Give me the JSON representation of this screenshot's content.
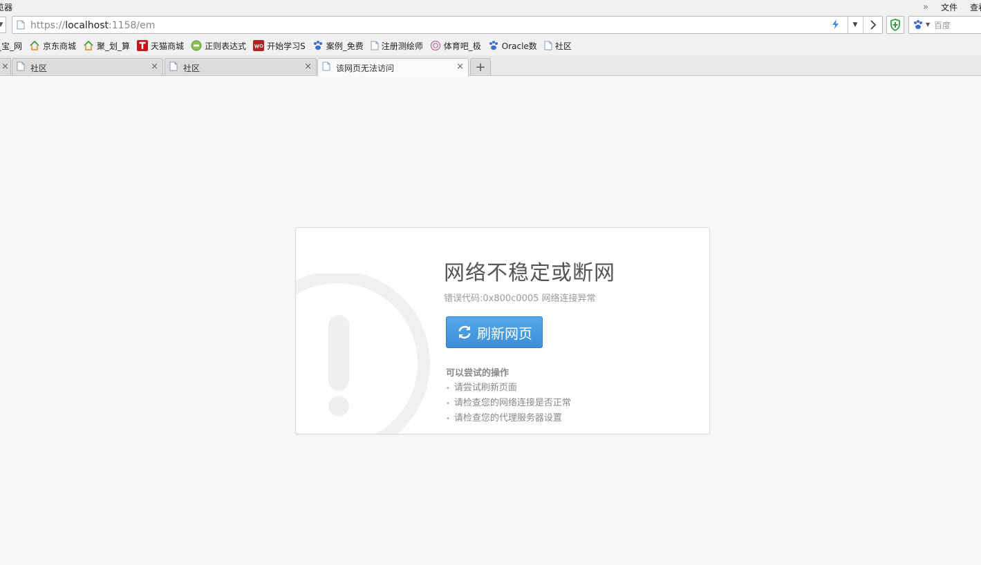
{
  "window": {
    "app_name_partial": "览器",
    "menu": [
      "文件",
      "查看"
    ]
  },
  "address": {
    "url_scheme": "https://",
    "url_host": "localhost",
    "url_rest": ":1158/em",
    "search_placeholder": "百度"
  },
  "bookmarks": [
    {
      "label": "_宝_网",
      "icon": "none"
    },
    {
      "label": "京东商城",
      "icon": "house-2345-icon"
    },
    {
      "label": "聚_划_算",
      "icon": "house-2345-icon"
    },
    {
      "label": "天猫商城",
      "icon": "tmall-icon"
    },
    {
      "label": "正则表达式",
      "icon": "green-circle-icon"
    },
    {
      "label": "开始学习S",
      "icon": "w3c-icon"
    },
    {
      "label": "案例_免费",
      "icon": "paw-icon"
    },
    {
      "label": "注册测绘师",
      "icon": "page-icon"
    },
    {
      "label": "体育吧_极",
      "icon": "swirl-icon"
    },
    {
      "label": "Oracle数",
      "icon": "paw-icon"
    },
    {
      "label": "社区",
      "icon": "page-icon"
    }
  ],
  "tabs": [
    {
      "label": "社区",
      "active": false
    },
    {
      "label": "社区",
      "active": false
    },
    {
      "label": "该网页无法访问",
      "active": true
    }
  ],
  "tab_close_glyph": "×",
  "newtab_glyph": "+",
  "error": {
    "title": "网络不稳定或断网",
    "code_text": "错误代码:0x800c0005 网络连接异常",
    "refresh_label": "刷新网页",
    "suggestions_title": "可以尝试的操作",
    "suggestions": [
      "请尝试刷新页面",
      "请检查您的网络连接是否正常",
      "请检查您的代理服务器设置"
    ]
  },
  "colors": {
    "button_blue": "#3a8fd8",
    "page_bg": "#f8f8f8",
    "shield_green": "#2e9e3e",
    "bolt_blue": "#3b8ee0"
  }
}
